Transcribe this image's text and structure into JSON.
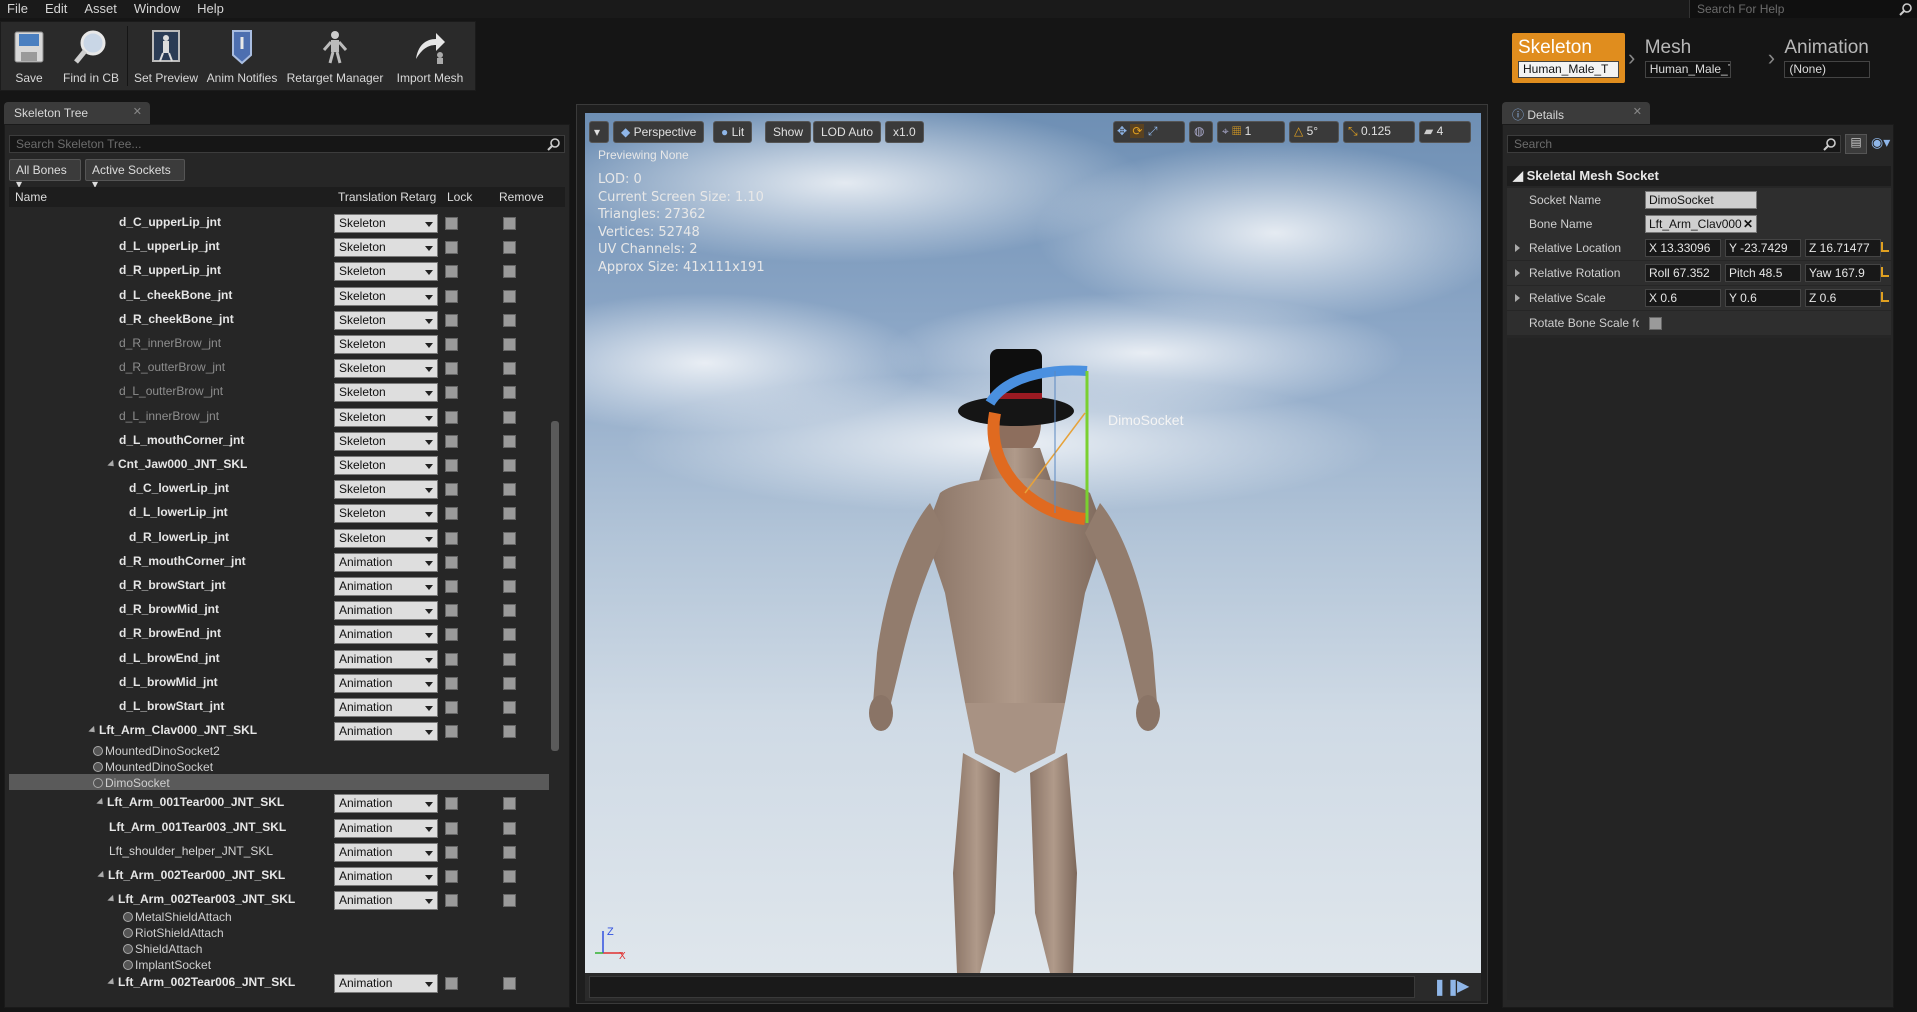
{
  "menu": [
    "File",
    "Edit",
    "Asset",
    "Window",
    "Help"
  ],
  "help_search_placeholder": "Search For Help",
  "toolbar": {
    "save": "Save",
    "find_in_cb": "Find in CB",
    "set_preview": "Set Preview",
    "anim_notifies": "Anim Notifies",
    "retarget_manager": "Retarget Manager",
    "import_mesh": "Import Mesh"
  },
  "modes": {
    "skeleton": {
      "label": "Skeleton",
      "value": "Human_Male_T"
    },
    "mesh": {
      "label": "Mesh",
      "value": "Human_Male_T"
    },
    "animation": {
      "label": "Animation",
      "value": "(None)"
    }
  },
  "skeleton_tree": {
    "tab": "Skeleton Tree",
    "search_placeholder": "Search Skeleton Tree...",
    "filter_bones": "All Bones",
    "filter_sockets": "Active Sockets",
    "columns": {
      "name": "Name",
      "translation": "Translation Retarg",
      "lock": "Lock",
      "remove": "Remove"
    },
    "rows": [
      {
        "name": "d_C_upperLip_jnt",
        "mode": "Skeleton",
        "indent": 1,
        "kind": "bone"
      },
      {
        "name": "d_L_upperLip_jnt",
        "mode": "Skeleton",
        "indent": 1,
        "kind": "bone"
      },
      {
        "name": "d_R_upperLip_jnt",
        "mode": "Skeleton",
        "indent": 1,
        "kind": "bone"
      },
      {
        "name": "d_L_cheekBone_jnt",
        "mode": "Skeleton",
        "indent": 1,
        "kind": "bone"
      },
      {
        "name": "d_R_cheekBone_jnt",
        "mode": "Skeleton",
        "indent": 1,
        "kind": "bone"
      },
      {
        "name": "d_R_innerBrow_jnt",
        "mode": "Skeleton",
        "indent": 1,
        "kind": "dim"
      },
      {
        "name": "d_R_outterBrow_jnt",
        "mode": "Skeleton",
        "indent": 1,
        "kind": "dim"
      },
      {
        "name": "d_L_outterBrow_jnt",
        "mode": "Skeleton",
        "indent": 1,
        "kind": "dim"
      },
      {
        "name": "d_L_innerBrow_jnt",
        "mode": "Skeleton",
        "indent": 1,
        "kind": "dim"
      },
      {
        "name": "d_L_mouthCorner_jnt",
        "mode": "Skeleton",
        "indent": 1,
        "kind": "bone"
      },
      {
        "name": "Cnt_Jaw000_JNT_SKL",
        "mode": "Skeleton",
        "indent": 0.9,
        "kind": "bone",
        "expand": true
      },
      {
        "name": "d_C_lowerLip_jnt",
        "mode": "Skeleton",
        "indent": 2,
        "kind": "bone"
      },
      {
        "name": "d_L_lowerLip_jnt",
        "mode": "Skeleton",
        "indent": 2,
        "kind": "bone"
      },
      {
        "name": "d_R_lowerLip_jnt",
        "mode": "Skeleton",
        "indent": 2,
        "kind": "bone"
      },
      {
        "name": "d_R_mouthCorner_jnt",
        "mode": "Animation",
        "indent": 1,
        "kind": "bone"
      },
      {
        "name": "d_R_browStart_jnt",
        "mode": "Animation",
        "indent": 1,
        "kind": "bone"
      },
      {
        "name": "d_R_browMid_jnt",
        "mode": "Animation",
        "indent": 1,
        "kind": "bone"
      },
      {
        "name": "d_R_browEnd_jnt",
        "mode": "Animation",
        "indent": 1,
        "kind": "bone"
      },
      {
        "name": "d_L_browEnd_jnt",
        "mode": "Animation",
        "indent": 1,
        "kind": "bone"
      },
      {
        "name": "d_L_browMid_jnt",
        "mode": "Animation",
        "indent": 1,
        "kind": "bone"
      },
      {
        "name": "d_L_browStart_jnt",
        "mode": "Animation",
        "indent": 1,
        "kind": "bone"
      },
      {
        "name": "Lft_Arm_Clav000_JNT_SKL",
        "mode": "Animation",
        "indent": -1,
        "kind": "bone",
        "expand": true
      }
    ],
    "sockets_a": [
      "MountedDinoSocket2",
      "MountedDinoSocket",
      "DimoSocket"
    ],
    "rows_b": [
      {
        "name": "Lft_Arm_001Tear000_JNT_SKL",
        "mode": "Animation",
        "indent": -0.2,
        "kind": "bone",
        "expand": true
      },
      {
        "name": "Lft_Arm_001Tear003_JNT_SKL",
        "mode": "Animation",
        "indent": 0,
        "kind": "bone"
      },
      {
        "name": "Lft_shoulder_helper_JNT_SKL",
        "mode": "Animation",
        "indent": 0,
        "kind": "light"
      },
      {
        "name": "Lft_Arm_002Tear000_JNT_SKL",
        "mode": "Animation",
        "indent": -0.1,
        "kind": "bone",
        "expand": true
      },
      {
        "name": "Lft_Arm_002Tear003_JNT_SKL",
        "mode": "Animation",
        "indent": 0.9,
        "kind": "bone",
        "expand": true
      }
    ],
    "sockets_b": [
      "MetalShieldAttach",
      "RiotShieldAttach",
      "ShieldAttach",
      "ImplantSocket"
    ],
    "row_last": {
      "name": "Lft_Arm_002Tear006_JNT_SKL",
      "mode": "Animation"
    }
  },
  "viewport": {
    "perspective": "Perspective",
    "lit": "Lit",
    "show": "Show",
    "lod": "LOD Auto",
    "speed": "x1.0",
    "grid_num": "1",
    "angle": "5°",
    "scale": "0.125",
    "cam_speed": "4",
    "previewing": "Previewing None",
    "stats": [
      "LOD: 0",
      "Current Screen Size: 1.10",
      "Triangles: 27362",
      "Vertices: 52748",
      "UV Channels: 2",
      "Approx Size: 41x111x191"
    ],
    "socket_label": "DimoSocket"
  },
  "details": {
    "tab": "Details",
    "search_placeholder": "Search",
    "section": "Skeletal Mesh Socket",
    "socket_name_label": "Socket Name",
    "socket_name": "DimoSocket",
    "bone_name_label": "Bone Name",
    "bone_name": "Lft_Arm_Clav000",
    "loc_label": "Relative Location",
    "loc": [
      "X 13.33096",
      "Y -23.7429",
      "Z 16.71477"
    ],
    "rot_label": "Relative Rotation",
    "rot": [
      "Roll 67.352",
      "Pitch 48.5",
      "Yaw 167.9"
    ],
    "scale_label": "Relative Scale",
    "scale": [
      "X 0.6",
      "Y 0.6",
      "Z 0.6"
    ],
    "rotate_bone_label": "Rotate Bone Scale for"
  },
  "colors": {
    "accent": "#e08d1e",
    "panel": "#262626",
    "gizmo_blue": "#4a90e0",
    "gizmo_orange": "#e06a20",
    "gizmo_green": "#7ad030"
  }
}
